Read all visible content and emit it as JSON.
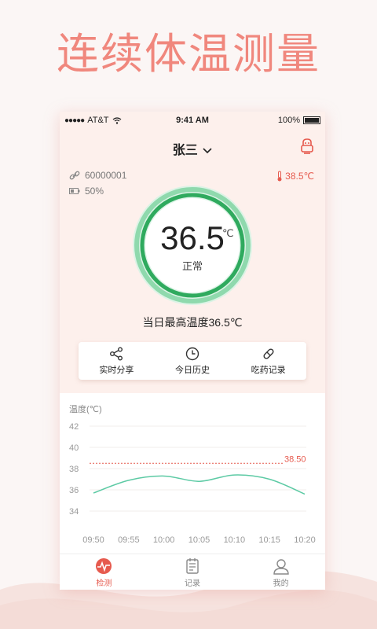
{
  "headline": "连续体温测量",
  "statusbar": {
    "carrier": "AT&T",
    "time": "9:41 AM",
    "battery": "100%"
  },
  "user": {
    "name": "张三"
  },
  "device": {
    "id": "60000001",
    "battery": "50%"
  },
  "alert_temp": "38.5℃",
  "gauge": {
    "value": "36.5",
    "unit": "℃",
    "status": "正常"
  },
  "max_temp_text": "当日最高温度36.5℃",
  "actions": [
    {
      "label": "实时分享",
      "icon": "share-icon"
    },
    {
      "label": "今日历史",
      "icon": "clock-icon"
    },
    {
      "label": "吃药记录",
      "icon": "pill-icon"
    }
  ],
  "chart_data": {
    "type": "line",
    "ylabel": "温度(℃)",
    "x": [
      "09:50",
      "09:55",
      "10:00",
      "10:05",
      "10:10",
      "10:15",
      "10:20"
    ],
    "y_ticks": [
      42,
      40,
      38,
      36,
      34
    ],
    "ylim": [
      34,
      42
    ],
    "threshold": {
      "value": 38.5,
      "label": "38.50"
    },
    "series": [
      {
        "values": [
          35.7,
          36.9,
          37.3,
          36.8,
          37.4,
          37.0,
          35.6
        ]
      }
    ],
    "colors": {
      "line": "#5ccaa4",
      "threshold": "#e65a4e"
    }
  },
  "tabs": [
    {
      "label": "检测",
      "icon": "pulse-icon",
      "active": true
    },
    {
      "label": "记录",
      "icon": "document-icon",
      "active": false
    },
    {
      "label": "我的",
      "icon": "user-icon",
      "active": false
    }
  ],
  "colors": {
    "accent": "#e65a4e",
    "gauge": "#2faa5e",
    "headline": "#f0877d"
  }
}
